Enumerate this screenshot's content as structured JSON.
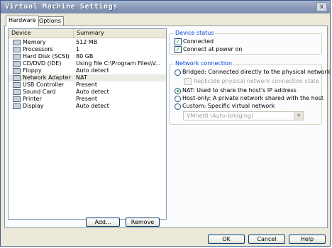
{
  "window": {
    "title": "Virtual Machine Settings",
    "close_label": "x"
  },
  "tabs": [
    {
      "label": "Hardware",
      "active": true
    },
    {
      "label": "Options",
      "active": false
    }
  ],
  "device_list": {
    "headers": {
      "device": "Device",
      "summary": "Summary"
    },
    "rows": [
      {
        "device": "Memory",
        "summary": "512 MB",
        "icon": "memory-icon"
      },
      {
        "device": "Processors",
        "summary": "1",
        "icon": "processor-icon"
      },
      {
        "device": "Hard Disk (SCSI)",
        "summary": "80 GB",
        "icon": "hard-disk-icon"
      },
      {
        "device": "CD/DVD (IDE)",
        "summary": "Using file C:\\Program Files\\V...",
        "icon": "cd-dvd-icon"
      },
      {
        "device": "Floppy",
        "summary": "Auto detect",
        "icon": "floppy-icon"
      },
      {
        "device": "Network Adapter",
        "summary": "NAT",
        "icon": "network-adapter-icon",
        "selected": true
      },
      {
        "device": "USB Controller",
        "summary": "Present",
        "icon": "usb-icon"
      },
      {
        "device": "Sound Card",
        "summary": "Auto detect",
        "icon": "sound-card-icon"
      },
      {
        "device": "Printer",
        "summary": "Present",
        "icon": "printer-icon"
      },
      {
        "device": "Display",
        "summary": "Auto detect",
        "icon": "display-icon"
      }
    ]
  },
  "buttons": {
    "add": "Add...",
    "remove": "Remove",
    "ok": "OK",
    "cancel": "Cancel",
    "help": "Help"
  },
  "device_status": {
    "title": "Device status",
    "connected": "Connected",
    "connect_at_power_on": "Connect at power on"
  },
  "network_connection": {
    "title": "Network connection",
    "bridged": "Bridged: Connected directly to the physical network",
    "replicate": "Replicate physical network connection state",
    "nat": "NAT: Used to share the host's IP address",
    "host_only": "Host-only: A private network shared with the host",
    "custom": "Custom: Specific virtual network",
    "custom_select": "VMnet0 (Auto-bridging)",
    "selected": "nat"
  },
  "colors": {
    "titlebar": "#8797b8",
    "group_title": "#0046d5",
    "check": "#21a121"
  }
}
